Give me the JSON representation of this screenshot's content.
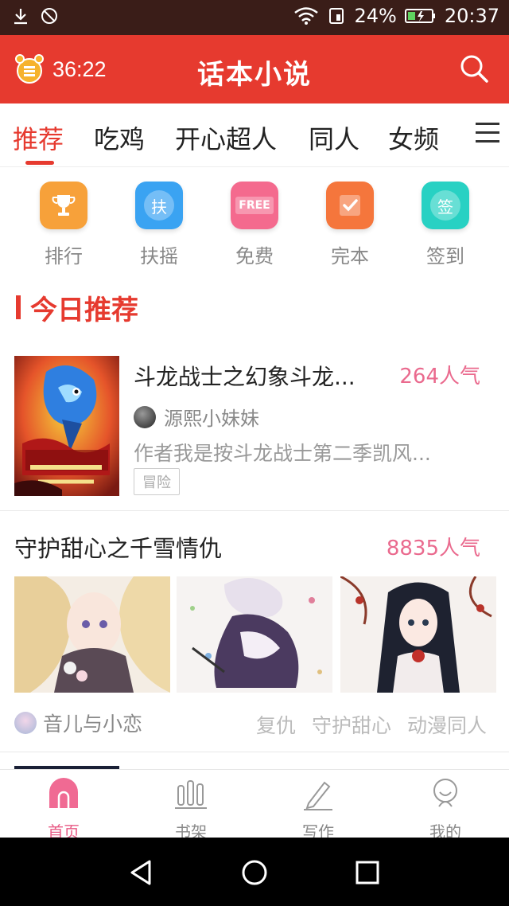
{
  "status_bar": {
    "battery": "24%",
    "time": "20:37"
  },
  "header": {
    "timer": "36:22",
    "title": "话本小说"
  },
  "tabs": [
    {
      "label": "推荐"
    },
    {
      "label": "吃鸡"
    },
    {
      "label": "开心超人"
    },
    {
      "label": "同人"
    },
    {
      "label": "女频"
    }
  ],
  "quick_links": [
    {
      "label": "排行",
      "icon": "trophy-icon",
      "color": "#f7a13a"
    },
    {
      "label": "扶摇",
      "icon_text": "扶",
      "icon": "fuyao-icon",
      "color": "#3aa3f2"
    },
    {
      "label": "免费",
      "icon_text": "FREE",
      "icon": "free-icon",
      "color": "#f46a8e"
    },
    {
      "label": "完本",
      "icon": "checkbox-icon",
      "color": "#f5763c"
    },
    {
      "label": "签到",
      "icon_text": "签",
      "icon": "checkin-icon",
      "color": "#28d1c3"
    }
  ],
  "section": {
    "title": "今日推荐"
  },
  "book1": {
    "title": "斗龙战士之幻象斗龙...",
    "popularity": "264人气",
    "author": "源熙小妹妹",
    "description": "作者我是按斗龙战士第二季凯风...",
    "tag": "冒险"
  },
  "book2": {
    "title": "守护甜心之千雪情仇",
    "popularity": "8835人气",
    "author": "音儿与小恋",
    "tags": [
      "复仇",
      "守护甜心",
      "动漫同人"
    ]
  },
  "bottom_nav": [
    {
      "label": "首页",
      "icon": "home-icon"
    },
    {
      "label": "书架",
      "icon": "bookshelf-icon"
    },
    {
      "label": "写作",
      "icon": "pen-icon"
    },
    {
      "label": "我的",
      "icon": "profile-icon"
    }
  ],
  "colors": {
    "brand_red": "#e63a2f",
    "pink": "#ea6a8e",
    "status_bar_bg": "#3a1d18"
  }
}
